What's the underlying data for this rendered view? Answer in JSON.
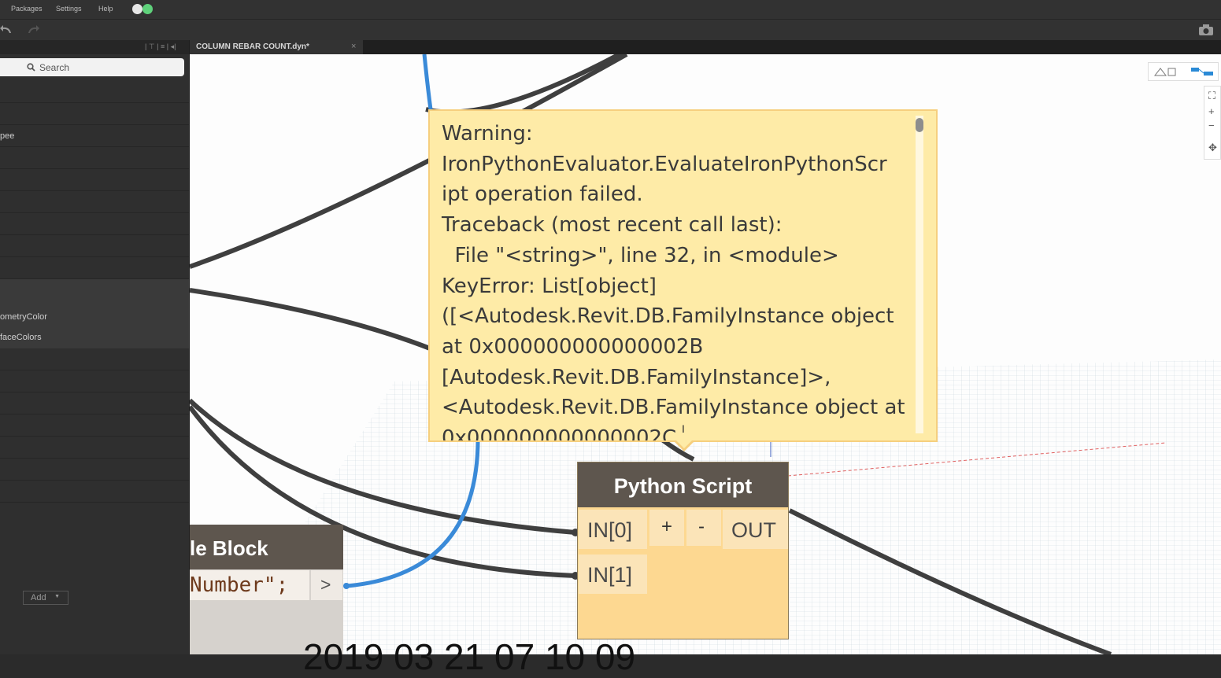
{
  "menu": {
    "packages": "Packages",
    "settings": "Settings",
    "help": "Help"
  },
  "library": {
    "search_placeholder": "Search",
    "rows": [
      "",
      "",
      "pee",
      "",
      "",
      "",
      "",
      "",
      ""
    ],
    "sub_items": [
      "ometryColor",
      "faceColors"
    ],
    "add_label": "Add"
  },
  "tab": {
    "title": "COLUMN REBAR COUNT.dyn*",
    "close": "×"
  },
  "warning": {
    "text": "Warning:\nIronPythonEvaluator.EvaluateIronPythonScr\nipt operation failed.\nTraceback (most recent call last):\n  File \"<string>\", line 32, in <module>\nKeyError: List[object]\n([<Autodesk.Revit.DB.FamilyInstance object\nat 0x000000000000002B\n[Autodesk.Revit.DB.FamilyInstance]>,\n<Autodesk.Revit.DB.FamilyInstance object at\n0x000000000000002C"
  },
  "python_node": {
    "title": "Python Script",
    "in0": "IN[0]",
    "in1": "IN[1]",
    "add": "+",
    "remove": "-",
    "out": "OUT"
  },
  "code_block": {
    "title": "le Block",
    "code": "Number\";",
    "port": ">"
  },
  "watermark": "2019 03 21 07 10 09"
}
